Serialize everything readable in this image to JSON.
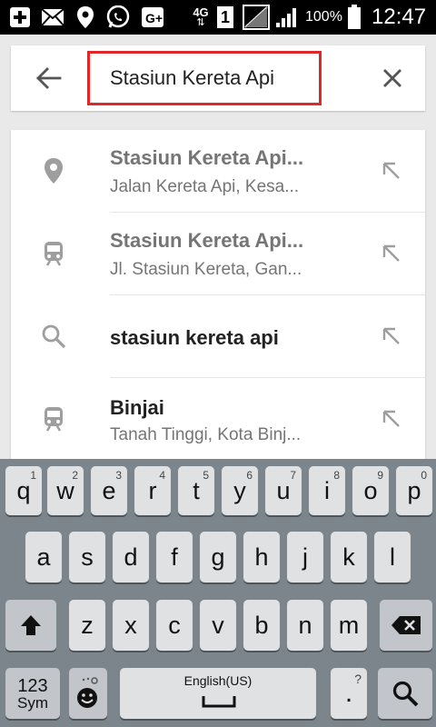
{
  "status_bar": {
    "network": "4G",
    "sim_slot": "1",
    "battery": "100%",
    "time": "12:47",
    "icons": [
      "plus-icon",
      "mail-icon",
      "location-pin-icon",
      "whatsapp-icon",
      "gplus-icon",
      "network-4g-icon",
      "sim-1-icon",
      "no-signal-icon",
      "signal-icon",
      "battery-icon"
    ]
  },
  "search": {
    "query": "Stasiun Kereta Api",
    "highlight_color": "#e0272a"
  },
  "results": [
    {
      "icon": "location-pin-icon",
      "title": "Stasiun Kereta Api...",
      "subtitle": "Jalan Kereta Api, Kesa...",
      "title_style": "muted"
    },
    {
      "icon": "train-icon",
      "title": "Stasiun Kereta Api...",
      "subtitle": "Jl. Stasiun Kereta, Gan...",
      "title_style": "muted"
    },
    {
      "icon": "search-icon",
      "title": "stasiun kereta api",
      "subtitle": "",
      "title_style": "dark"
    },
    {
      "icon": "train-icon",
      "title": "Binjai",
      "subtitle": "Tanah Tinggi, Kota Binj...",
      "title_style": "dark"
    }
  ],
  "keyboard": {
    "row1": [
      {
        "k": "q",
        "n": "1"
      },
      {
        "k": "w",
        "n": "2"
      },
      {
        "k": "e",
        "n": "3"
      },
      {
        "k": "r",
        "n": "4"
      },
      {
        "k": "t",
        "n": "5"
      },
      {
        "k": "y",
        "n": "6"
      },
      {
        "k": "u",
        "n": "7"
      },
      {
        "k": "i",
        "n": "8"
      },
      {
        "k": "o",
        "n": "9"
      },
      {
        "k": "p",
        "n": "0"
      }
    ],
    "row2": [
      "a",
      "s",
      "d",
      "f",
      "g",
      "h",
      "j",
      "k",
      "l"
    ],
    "row3": [
      "z",
      "x",
      "c",
      "v",
      "b",
      "n",
      "m"
    ],
    "sym_top": "123",
    "sym_bottom": "Sym",
    "space_label": "English(US)",
    "period": ".",
    "period_hint": "?"
  }
}
